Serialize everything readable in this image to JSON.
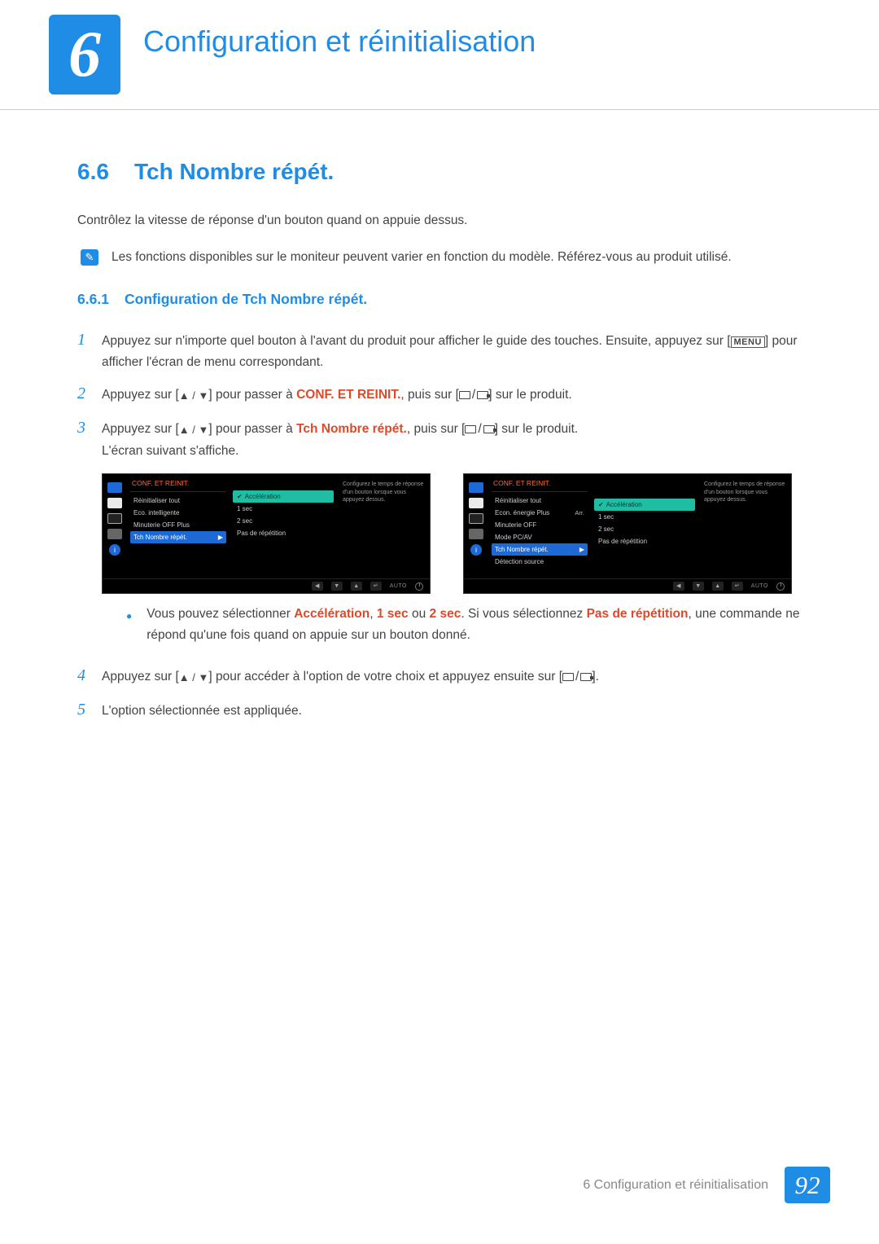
{
  "header": {
    "chapter_number": "6",
    "chapter_title": "Configuration et réinitialisation"
  },
  "section": {
    "number": "6.6",
    "title": "Tch Nombre répét.",
    "intro": "Contrôlez la vitesse de réponse d'un bouton quand on appuie dessus."
  },
  "note": {
    "text": "Les fonctions disponibles sur le moniteur peuvent varier en fonction du modèle. Référez-vous au produit utilisé."
  },
  "subsection": {
    "number": "6.6.1",
    "title": "Configuration de Tch Nombre répét."
  },
  "steps": {
    "s1a": "Appuyez sur n'importe quel bouton à l'avant du produit pour afficher le guide des touches. Ensuite, appuyez sur [",
    "s1_menu": "MENU",
    "s1b": "] pour afficher l'écran de menu correspondant.",
    "s2a": "Appuyez sur [",
    "s2b": "] pour passer à ",
    "s2_hl": "CONF. ET REINIT.",
    "s2c": ", puis sur [",
    "s2d": "] sur le produit.",
    "s3a": "Appuyez sur [",
    "s3b": "] pour passer à ",
    "s3_hl": "Tch Nombre répét.",
    "s3c": ", puis sur [",
    "s3d": "] sur le produit.",
    "s3e": "L'écran suivant s'affiche.",
    "s4a": "Appuyez sur [",
    "s4b": "] pour accéder à l'option de votre choix et appuyez ensuite sur [",
    "s4c": "].",
    "s5": "L'option sélectionnée est appliquée."
  },
  "bullet": {
    "pre": "Vous pouvez sélectionner ",
    "h1": "Accélération",
    "sep1": ", ",
    "h2": "1 sec",
    "sep2": " ou ",
    "h3": "2 sec",
    "post1": ". Si vous sélectionnez ",
    "h4": "Pas de répétition",
    "post2": ", une commande ne répond qu'une fois quand on appuie sur un bouton donné."
  },
  "osd": {
    "title": "CONF. ET REINIT.",
    "desc": "Configurez le temps de réponse d'un bouton lorsque vous appuyez dessus.",
    "left": {
      "items": [
        {
          "label": "Réinitialiser tout",
          "value": ""
        },
        {
          "label": "Eco. intelligente",
          "value": ""
        },
        {
          "label": "Minuterie OFF Plus",
          "value": ""
        },
        {
          "label": "Tch Nombre répét.",
          "value": "",
          "active": true
        }
      ],
      "sub": [
        {
          "label": "Accélération",
          "active": true
        },
        {
          "label": "1 sec"
        },
        {
          "label": "2 sec"
        },
        {
          "label": "Pas de répétition"
        }
      ]
    },
    "right": {
      "items": [
        {
          "label": "Réinitialiser tout",
          "value": ""
        },
        {
          "label": "Econ. énergie Plus",
          "value": "Arr."
        },
        {
          "label": "Minuterie OFF",
          "value": ""
        },
        {
          "label": "Mode PC/AV",
          "value": ""
        },
        {
          "label": "Tch Nombre répét.",
          "value": "",
          "active": true
        },
        {
          "label": "Détection source",
          "value": ""
        }
      ],
      "sub": [
        {
          "label": "Accélération",
          "active": true
        },
        {
          "label": "1 sec"
        },
        {
          "label": "2 sec"
        },
        {
          "label": "Pas de répétition"
        }
      ]
    },
    "auto": "AUTO"
  },
  "footer": {
    "text": "6  Configuration et réinitialisation",
    "page": "92"
  }
}
